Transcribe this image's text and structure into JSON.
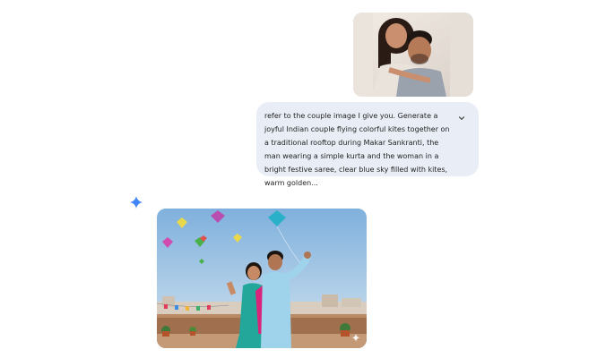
{
  "conversation": {
    "user_message": {
      "attached_image": {
        "icon": "uploaded-couple-photo"
      },
      "prompt_text": "refer to the couple image I give you. Generate a joyful Indian couple flying colorful kites together on a traditional rooftop during Makar Sankranti, the man wearing a simple kurta and the woman in a bright festive saree, clear blue sky filled with kites, warm golden...",
      "expand_icon": "chevron-down-icon"
    },
    "assistant_message": {
      "avatar_icon": "gemini-sparkle-icon",
      "generated_image": {
        "icon": "generated-kite-festival-image",
        "badge_icon": "sparkle-watermark-icon"
      }
    }
  },
  "colors": {
    "bubble_background": "#e9eef6",
    "sparkle_blue": "#4285f4",
    "sky": "#8fb9de"
  }
}
